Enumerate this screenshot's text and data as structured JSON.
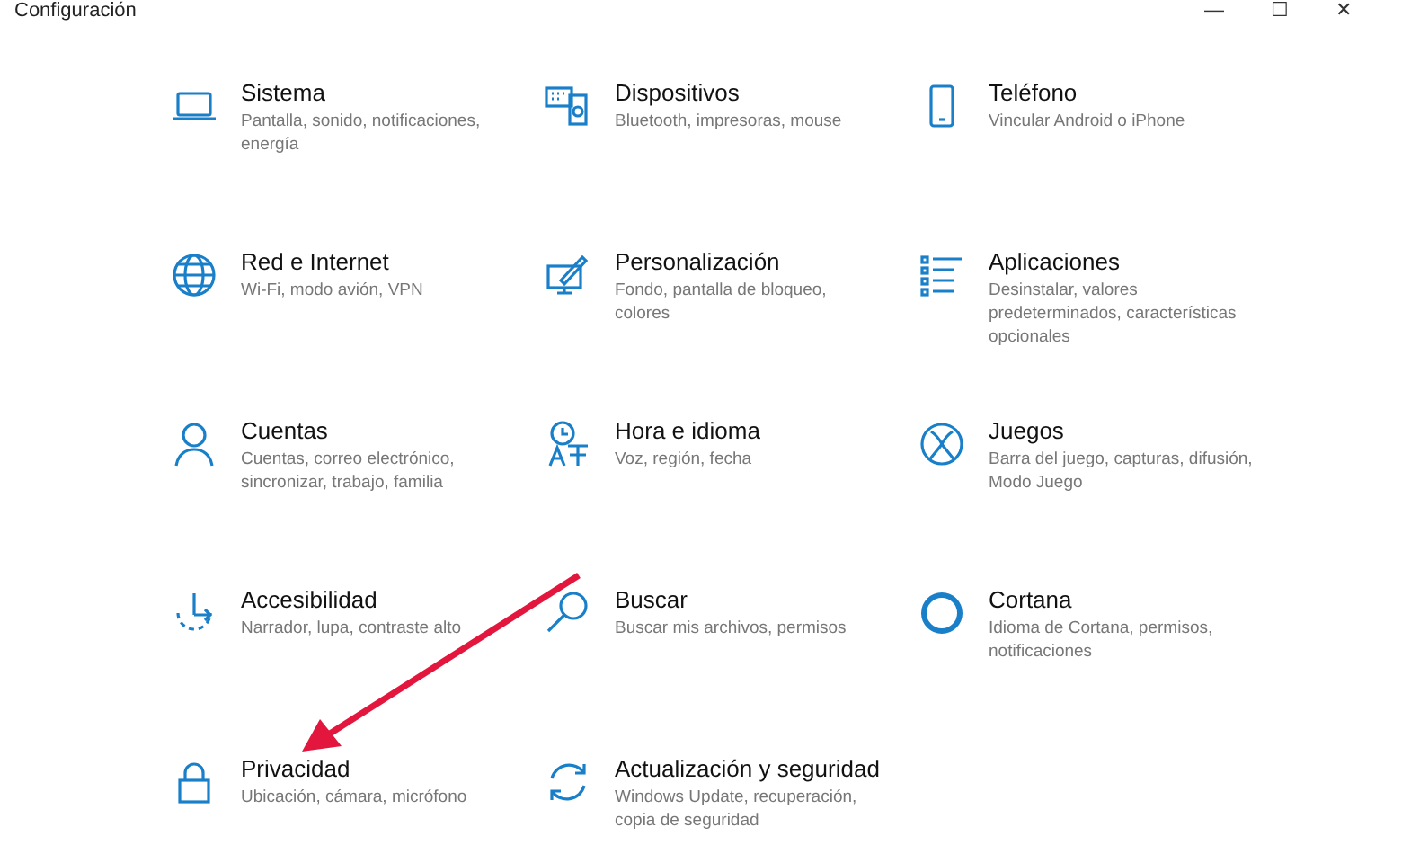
{
  "window": {
    "title": "Configuración",
    "controls": [
      "—",
      "☐",
      "✕"
    ]
  },
  "items": [
    {
      "title": "Sistema",
      "description": "Pantalla, sonido, notificaciones, energía"
    },
    {
      "title": "Dispositivos",
      "description": "Bluetooth, impresoras, mouse"
    },
    {
      "title": "Teléfono",
      "description": "Vincular Android o iPhone"
    },
    {
      "title": "Red e Internet",
      "description": "Wi-Fi, modo avión, VPN"
    },
    {
      "title": "Personalización",
      "description": "Fondo, pantalla de bloqueo, colores"
    },
    {
      "title": "Aplicaciones",
      "description": "Desinstalar, valores predeterminados, características opcionales"
    },
    {
      "title": "Cuentas",
      "description": "Cuentas, correo electrónico, sincronizar, trabajo, familia"
    },
    {
      "title": "Hora e idioma",
      "description": "Voz, región, fecha"
    },
    {
      "title": "Juegos",
      "description": "Barra del juego, capturas, difusión, Modo Juego"
    },
    {
      "title": "Accesibilidad",
      "description": "Narrador, lupa, contraste alto"
    },
    {
      "title": "Buscar",
      "description": "Buscar mis archivos, permisos"
    },
    {
      "title": "Cortana",
      "description": "Idioma de Cortana, permisos, notificaciones"
    },
    {
      "title": "Privacidad",
      "description": "Ubicación, cámara, micrófono"
    },
    {
      "title": "Actualización y seguridad",
      "description": "Windows Update, recuperación, copia de seguridad"
    }
  ]
}
